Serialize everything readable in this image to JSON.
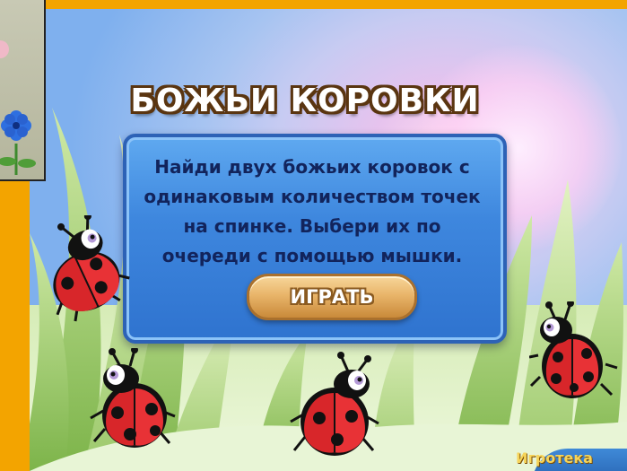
{
  "game": {
    "title": "БОЖЬИ КОРОВКИ",
    "instructions": [
      "Найди двух божьих коровок с",
      "одинаковым количеством точек",
      "на спинке. Выбери их по",
      "очереди с помощью мышки."
    ],
    "play_label": "ИГРАТЬ",
    "brand": "Игротека"
  },
  "colors": {
    "frame": "#f3a400",
    "panel": "#3e87de",
    "panel_text": "#12245c",
    "ladybug_red": "#d8262a",
    "title_outline": "#5a3510"
  },
  "ladybugs": [
    {
      "id": "ladybug-left-top",
      "dots": 3
    },
    {
      "id": "ladybug-bottom-left",
      "dots": 4
    },
    {
      "id": "ladybug-bottom-center",
      "dots": 3
    },
    {
      "id": "ladybug-right",
      "dots": 5
    }
  ]
}
